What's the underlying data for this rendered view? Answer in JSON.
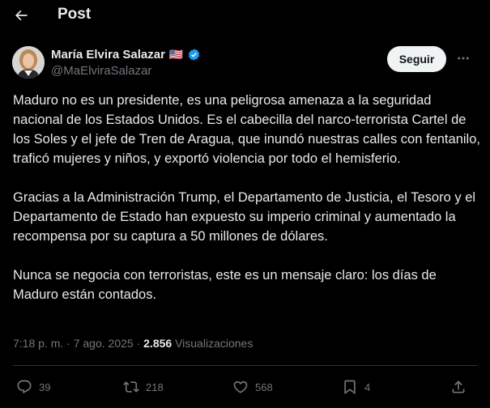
{
  "header": {
    "title": "Post"
  },
  "post": {
    "author": {
      "name": "María Elvira Salazar",
      "handle": "@MaElviraSalazar",
      "flag": "🇺🇸"
    },
    "follow_label": "Seguir",
    "paragraphs": [
      "Maduro no es un presidente, es una peligrosa amenaza a la seguridad nacional de los Estados Unidos. Es el cabecilla del narco-terrorista Cartel de los Soles y el jefe de Tren de Aragua, que inundó nuestras calles con fentanilo, traficó mujeres y niños, y exportó violencia por todo el hemisferio.",
      "Gracias a la Administración Trump, el Departamento de Justicia, el Tesoro y el Departamento de Estado han expuesto su imperio criminal y aumentado la recompensa por su captura a 50 millones de dólares.",
      "Nunca se negocia con terroristas, este es un mensaje claro: los días de Maduro están contados."
    ],
    "time": "7:18 p. m.",
    "separator": "·",
    "date": "7 ago. 2025",
    "views_count": "2.856",
    "views_label": "Visualizaciones"
  },
  "actions": {
    "replies": "39",
    "reposts": "218",
    "likes": "568",
    "bookmarks": "4"
  },
  "colors": {
    "background": "#000000",
    "text": "#e7e9ea",
    "muted": "#71767b",
    "verified": "#1d9bf0",
    "divider": "#2f3336"
  },
  "icons": [
    "back-arrow-icon",
    "verified-badge-icon",
    "flag-icon",
    "more-icon",
    "reply-icon",
    "repost-icon",
    "like-icon",
    "bookmark-icon",
    "share-icon"
  ]
}
